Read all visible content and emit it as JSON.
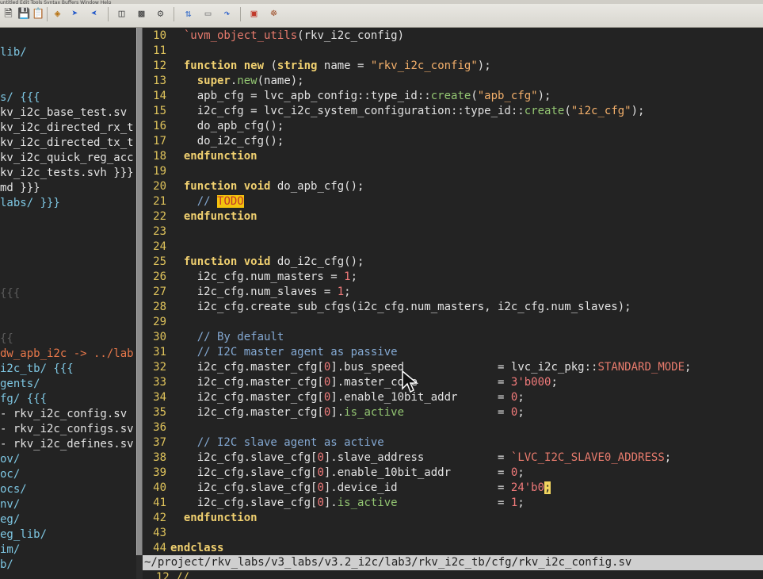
{
  "menu_strip": "untitled   Edit  Tools  Syntax  Buffers  Window  Help",
  "toolbar": {
    "icons": [
      "new-file-icon",
      "save-icon",
      "paste-icon",
      "find-icon",
      "forward-arrow-icon",
      "back-arrow-icon",
      "load-session-icon",
      "save-session-icon",
      "run-script-icon",
      "replace-icon",
      "undo-icon",
      "redo-icon",
      "make-icon",
      "help-icon"
    ]
  },
  "left_pane": {
    "lines": [
      {
        "text": "lib/",
        "style": "dir"
      },
      {
        "text": "",
        "style": "plain"
      },
      {
        "text": "",
        "style": "plain"
      },
      {
        "text": "s/ {{{",
        "style": "dir"
      },
      {
        "text": "kv_i2c_base_test.sv",
        "style": "plain"
      },
      {
        "text": "kv_i2c_directed_rx_t",
        "style": "plain"
      },
      {
        "text": "kv_i2c_directed_tx_t",
        "style": "plain"
      },
      {
        "text": "kv_i2c_quick_reg_acc",
        "style": "plain"
      },
      {
        "text": "kv_i2c_tests.svh }}}",
        "style": "plain"
      },
      {
        "text": "md }}}",
        "style": "plain"
      },
      {
        "text": "labs/ }}}",
        "style": "dir"
      },
      {
        "text": "",
        "style": "plain"
      },
      {
        "text": "",
        "style": "plain"
      },
      {
        "text": "",
        "style": "plain"
      },
      {
        "text": "",
        "style": "plain"
      },
      {
        "text": "",
        "style": "plain"
      },
      {
        "text": "{{{",
        "style": "fold"
      },
      {
        "text": "",
        "style": "plain"
      },
      {
        "text": "",
        "style": "plain"
      },
      {
        "text": "{{",
        "style": "fold"
      },
      {
        "text": "dw_apb_i2c -> ../lab",
        "style": "link"
      },
      {
        "text": "i2c_tb/ {{{",
        "style": "dir"
      },
      {
        "text": "gents/",
        "style": "dir"
      },
      {
        "text": "fg/ {{{",
        "style": "dir"
      },
      {
        "text": "- rkv_i2c_config.sv",
        "style": "plain"
      },
      {
        "text": "- rkv_i2c_configs.sv",
        "style": "plain"
      },
      {
        "text": "- rkv_i2c_defines.sv",
        "style": "plain"
      },
      {
        "text": "ov/",
        "style": "dir"
      },
      {
        "text": "oc/",
        "style": "dir"
      },
      {
        "text": "ocs/",
        "style": "dir"
      },
      {
        "text": "nv/",
        "style": "dir"
      },
      {
        "text": "eg/",
        "style": "dir"
      },
      {
        "text": "eg_lib/",
        "style": "dir"
      },
      {
        "text": "im/",
        "style": "dir"
      },
      {
        "text": "b/",
        "style": "dir"
      }
    ]
  },
  "editor": {
    "lines": [
      {
        "num": "10",
        "html": "  <span class=\"mac\">`uvm_object_utils</span>(rkv_i2c_config)"
      },
      {
        "num": "11",
        "html": ""
      },
      {
        "num": "12",
        "html": "  <span class=\"kw\">function</span> <span class=\"kw\">new</span> (<span class=\"kw\">string</span> name = <span class=\"str\">\"rkv_i2c_config\"</span>);"
      },
      {
        "num": "13",
        "html": "    <span class=\"kw\">super</span>.<span class=\"fnc\">new</span>(name);"
      },
      {
        "num": "14",
        "html": "    apb_cfg = lvc_apb_config::type_id::<span class=\"fnc\">create</span>(<span class=\"str\">\"apb_cfg\"</span>);"
      },
      {
        "num": "15",
        "html": "    i2c_cfg = lvc_i2c_system_configuration::type_id::<span class=\"fnc\">create</span>(<span class=\"str\">\"i2c_cfg\"</span>);"
      },
      {
        "num": "16",
        "html": "    do_apb_cfg();"
      },
      {
        "num": "17",
        "html": "    do_i2c_cfg();"
      },
      {
        "num": "18",
        "html": "  <span class=\"kw\">endfunction</span>"
      },
      {
        "num": "19",
        "html": ""
      },
      {
        "num": "20",
        "html": "  <span class=\"kw\">function</span> <span class=\"kw\">void</span> do_apb_cfg();"
      },
      {
        "num": "21",
        "html": "    <span class=\"cm\">// <span class=\"todo\">TODO</span></span>"
      },
      {
        "num": "22",
        "html": "  <span class=\"kw\">endfunction</span>"
      },
      {
        "num": "23",
        "html": ""
      },
      {
        "num": "24",
        "html": ""
      },
      {
        "num": "25",
        "html": "  <span class=\"kw\">function</span> <span class=\"kw\">void</span> do_i2c_cfg();"
      },
      {
        "num": "26",
        "html": "    i2c_cfg.num_masters = <span class=\"num\">1</span>;"
      },
      {
        "num": "27",
        "html": "    i2c_cfg.num_slaves = <span class=\"num\">1</span>;"
      },
      {
        "num": "28",
        "html": "    i2c_cfg.create_sub_cfgs(i2c_cfg.num_masters, i2c_cfg.num_slaves);"
      },
      {
        "num": "29",
        "html": ""
      },
      {
        "num": "30",
        "html": "    <span class=\"cm\">// By default</span>"
      },
      {
        "num": "31",
        "html": "    <span class=\"cm\">// I2C master agent as passive</span>"
      },
      {
        "num": "32",
        "html": "    i2c_cfg.master_cfg[<span class=\"num\">0</span>].bus_speed              = lvc_i2c_pkg::<span class=\"mac\">STANDARD_MODE</span>;"
      },
      {
        "num": "33",
        "html": "    i2c_cfg.master_cfg[<span class=\"num\">0</span>].master_code            = <span class=\"num\">3'b000</span>;"
      },
      {
        "num": "34",
        "html": "    i2c_cfg.master_cfg[<span class=\"num\">0</span>].enable_10bit_addr      = <span class=\"num\">0</span>;"
      },
      {
        "num": "35",
        "html": "    i2c_cfg.master_cfg[<span class=\"num\">0</span>].<span class=\"fnc\">is_active</span>              = <span class=\"num\">0</span>;"
      },
      {
        "num": "36",
        "html": ""
      },
      {
        "num": "37",
        "html": "    <span class=\"cm\">// I2C slave agent as active</span>"
      },
      {
        "num": "38",
        "html": "    i2c_cfg.slave_cfg[<span class=\"num\">0</span>].slave_address           = <span class=\"mac\">`LVC_I2C_SLAVE0_ADDRESS</span>;"
      },
      {
        "num": "39",
        "html": "    i2c_cfg.slave_cfg[<span class=\"num\">0</span>].enable_10bit_addr       = <span class=\"num\">0</span>;"
      },
      {
        "num": "40",
        "html": "    i2c_cfg.slave_cfg[<span class=\"num\">0</span>].device_id               = <span class=\"num\">24'b0</span><span class=\"cursor\">;</span>"
      },
      {
        "num": "41",
        "html": "    i2c_cfg.slave_cfg[<span class=\"num\">0</span>].<span class=\"fnc\">is_active</span>               = <span class=\"num\">1</span>;"
      },
      {
        "num": "42",
        "html": "  <span class=\"kw\">endfunction</span>"
      },
      {
        "num": "43",
        "html": ""
      },
      {
        "num": "44",
        "html": "<span class=\"kw\">endclass</span>"
      }
    ]
  },
  "status_bar": "~/project/rkv_labs/v3_labs/v3.2_i2c/lab3/rkv_i2c_tb/cfg/rkv_i2c_config.sv",
  "below_status": "  12 //"
}
